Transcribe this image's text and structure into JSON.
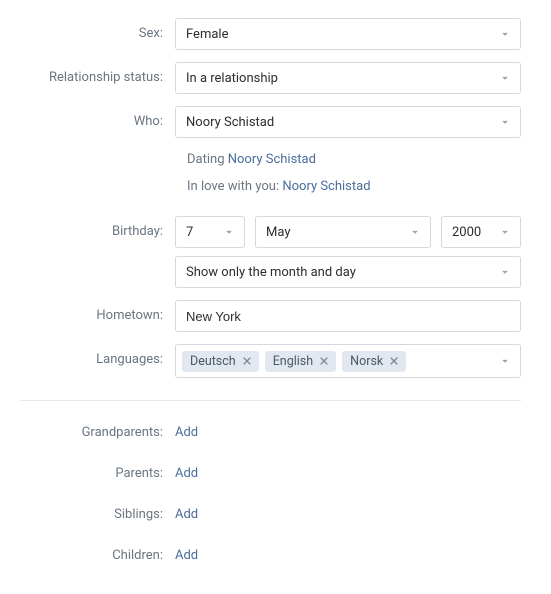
{
  "labels": {
    "sex": "Sex:",
    "relationship": "Relationship status:",
    "who": "Who:",
    "birthday": "Birthday:",
    "hometown": "Hometown:",
    "languages": "Languages:",
    "grandparents": "Grandparents:",
    "parents": "Parents:",
    "siblings": "Siblings:",
    "children": "Children:"
  },
  "values": {
    "sex": "Female",
    "relationship": "In a relationship",
    "who": "Noory Schistad",
    "birthday": {
      "day": "7",
      "month": "May",
      "year": "2000"
    },
    "birthday_visibility": "Show only the month and day",
    "hometown": "New York",
    "languages": [
      "Deutsch",
      "English",
      "Norsk"
    ]
  },
  "sublines": {
    "dating_prefix": "Dating ",
    "dating_name": "Noory Schistad",
    "inlove_prefix": "In love with you: ",
    "inlove_name": "Noory Schistad"
  },
  "relatives": {
    "add_label": "Add"
  }
}
